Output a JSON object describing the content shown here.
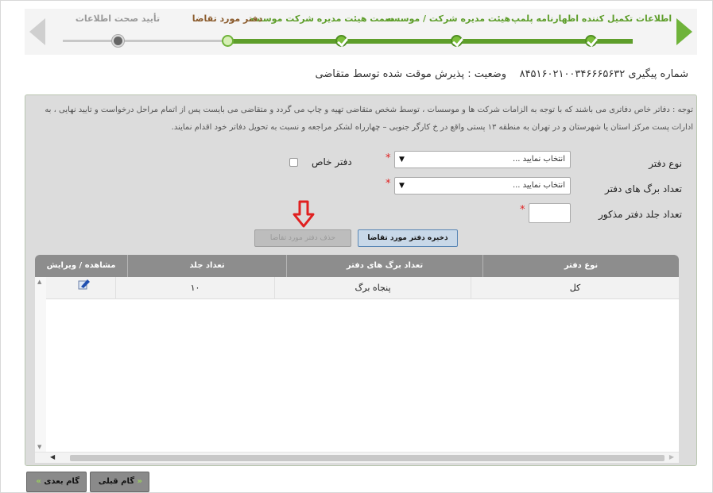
{
  "wizard": {
    "steps": [
      {
        "label": "اطلاعات تکمیل کننده اظهارنامه پلمپ",
        "status": "done"
      },
      {
        "label": "هیئت مدیره شرکت / موسسه",
        "status": "done"
      },
      {
        "label": "سمت هیئت مدیره شرکت موسسه",
        "status": "done"
      },
      {
        "label": "دفتر مورد تقاضا",
        "status": "current"
      },
      {
        "label": "تأیید صحت اطلاعات",
        "status": "future"
      }
    ],
    "colors": {
      "done": "#5e9e2b",
      "current_label": "#8a5a2b",
      "future_label": "#999999"
    }
  },
  "tracking": {
    "label": "شماره پیگیری",
    "number": "۸۴۵۱۶۰۲۱۰۰۳۴۶۶۶۵۶۳۲",
    "status_label": "وضعیت :",
    "status_value": "پذیرش موقت شده توسط متقاضی"
  },
  "notice": {
    "line1": "توجه : دفاتر خاص دفاتری می باشند که با توجه به الزامات شرکت ها و موسسات ، توسط شخص متقاضی تهیه و چاپ می گردد و متقاضی می بایست پس از اتمام مراحل درخواست و تایید نهایی ، به",
    "line2": "ادارات پست مرکز استان یا شهرستان و در تهران به منطقه ۱۳ پستی واقع در خ کارگر جنوبی – چهارراه لشکر مراجعه و نسبت به تحویل دفاتر خود اقدام نمایند."
  },
  "form": {
    "book_type_label": "نوع دفتر",
    "book_type_value": "انتخاب نمایید ...",
    "special_book_label": "دفتر خاص",
    "pages_label": "تعداد برگ های دفتر",
    "pages_value": "انتخاب نمایید ...",
    "volumes_label": "تعداد جلد دفتر مذکور",
    "volumes_value": "",
    "required_mark": "*"
  },
  "buttons": {
    "save": "ذخیره دفتر مورد تقاضا",
    "delete": "حذف دفتر مورد تقاضا",
    "prev": "گام قبلی",
    "next": "گام بعدی",
    "prev_chevron": "«",
    "next_chevron": "»"
  },
  "grid": {
    "columns": [
      "نوع دفتر",
      "تعداد برگ های دفتر",
      "تعداد جلد",
      "مشاهده / ویرایش"
    ],
    "rows": [
      {
        "type": "کل",
        "pages": "پنجاه برگ",
        "count": "۱۰"
      }
    ]
  }
}
